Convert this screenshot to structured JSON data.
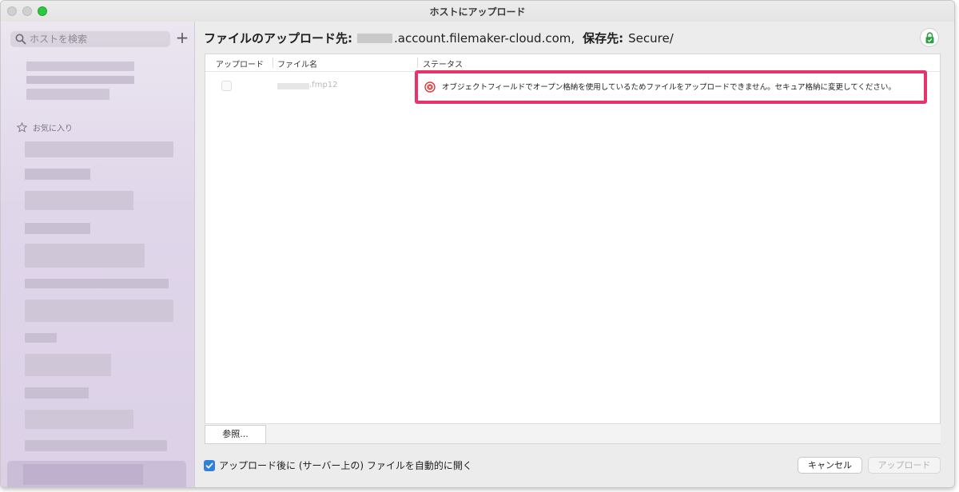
{
  "window": {
    "title": "ホストにアップロード"
  },
  "sidebar": {
    "search_placeholder": "ホストを検索",
    "add_label": "+",
    "favorites_label": "お気に入り"
  },
  "destination": {
    "prefix_label": "ファイルのアップロード先:",
    "host_suffix": ".account.filemaker-cloud.com,",
    "storage_label": "保存先:",
    "storage_value": "Secure/"
  },
  "table": {
    "columns": [
      "アップロード",
      "ファイル名",
      "ステータス"
    ],
    "rows": [
      {
        "file_name": ".fmp12",
        "status": "オブジェクトフィールドでオープン格納を使用しているためファイルをアップロードできません。セキュア格納に変更してください。",
        "status_type": "error"
      }
    ]
  },
  "browse_button": "参照...",
  "auto_open": {
    "label": "アップロード後に (サーバー上の) ファイルを自動的に開く",
    "checked": true
  },
  "buttons": {
    "cancel": "キャンセル",
    "upload": "アップロード"
  },
  "colors": {
    "highlight": "#e8336a",
    "error": "#d93a3a",
    "checkbox": "#2f7fdb",
    "lock": "#2ea043"
  }
}
